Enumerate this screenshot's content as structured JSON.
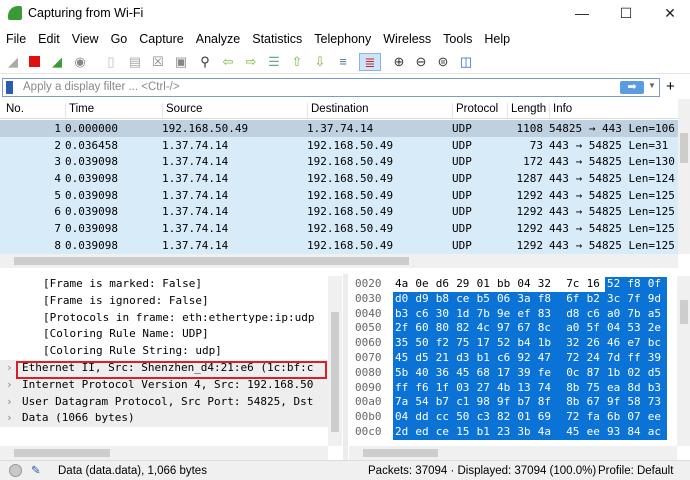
{
  "window": {
    "title": "Capturing from Wi-Fi"
  },
  "menu": [
    "File",
    "Edit",
    "View",
    "Go",
    "Capture",
    "Analyze",
    "Statistics",
    "Telephony",
    "Wireless",
    "Tools",
    "Help"
  ],
  "filter": {
    "placeholder": "Apply a display filter ... <Ctrl-/>"
  },
  "packet_list": {
    "columns": [
      "No.",
      "Time",
      "Source",
      "Destination",
      "Protocol",
      "Length",
      "Info"
    ],
    "rows": [
      [
        "1",
        "0.000000",
        "192.168.50.49",
        "1.37.74.14",
        "UDP",
        "1108",
        "54825 → 443 Len=106"
      ],
      [
        "2",
        "0.036458",
        "1.37.74.14",
        "192.168.50.49",
        "UDP",
        "73",
        "443 → 54825 Len=31"
      ],
      [
        "3",
        "0.039098",
        "1.37.74.14",
        "192.168.50.49",
        "UDP",
        "172",
        "443 → 54825 Len=130"
      ],
      [
        "4",
        "0.039098",
        "1.37.74.14",
        "192.168.50.49",
        "UDP",
        "1287",
        "443 → 54825 Len=124"
      ],
      [
        "5",
        "0.039098",
        "1.37.74.14",
        "192.168.50.49",
        "UDP",
        "1292",
        "443 → 54825 Len=125"
      ],
      [
        "6",
        "0.039098",
        "1.37.74.14",
        "192.168.50.49",
        "UDP",
        "1292",
        "443 → 54825 Len=125"
      ],
      [
        "7",
        "0.039098",
        "1.37.74.14",
        "192.168.50.49",
        "UDP",
        "1292",
        "443 → 54825 Len=125"
      ],
      [
        "8",
        "0.039098",
        "1.37.74.14",
        "192.168.50.49",
        "UDP",
        "1292",
        "443 → 54825 Len=125"
      ]
    ]
  },
  "details": {
    "sub": [
      "[Frame is marked: False]",
      "[Frame is ignored: False]",
      "[Protocols in frame: eth:ethertype:ip:udp",
      "[Coloring Rule Name: UDP]",
      "[Coloring Rule String: udp]"
    ],
    "top": [
      "Ethernet II, Src: Shenzhen_d4:21:e6 (1c:bf:c",
      "Internet Protocol Version 4, Src: 192.168.50",
      "User Datagram Protocol, Src Port: 54825, Dst",
      "Data (1066 bytes)"
    ]
  },
  "hex": [
    [
      "0020",
      "4a 0e d6 29 01 bb 04 32 7c 16 52 f8 0f"
    ],
    [
      "0030",
      "d0 d9 b8 ce b5 06 3a f8 6f b2 3c 7f 9d"
    ],
    [
      "0040",
      "b3 c6 30 1d 7b 9e ef 83 d8 c6 a0 7b a5"
    ],
    [
      "0050",
      "2f 60 80 82 4c 97 67 8c a0 5f 04 53 2e"
    ],
    [
      "0060",
      "35 50 f2 75 17 52 b4 1b 32 26 46 e7 bc"
    ],
    [
      "0070",
      "45 d5 21 d3 b1 c6 92 47 72 24 7d ff 39"
    ],
    [
      "0080",
      "5b 40 36 45 68 17 39 fe 0c 87 1b 02 d5"
    ],
    [
      "0090",
      "ff f6 1f 03 27 4b 13 74 8b 75 ea 8d b3"
    ],
    [
      "00a0",
      "7a 54 b7 c1 98 9f b7 8f 8b 67 9f 58 73"
    ],
    [
      "00b0",
      "04 dd cc 50 c3 82 01 69 72 fa 6b 07 ee"
    ],
    [
      "00c0",
      "2d ed ce 15 b1 23 3b 4a 45 ee 93 84 ac"
    ]
  ],
  "status": {
    "field": "Data (data.data), 1,066 bytes",
    "packets": "Packets: 37094 · Displayed: 37094 (100.0%)",
    "profile": "Profile: Default"
  },
  "colors": {
    "accent": "#0b73d6",
    "row": "#d7ebf9",
    "highlight": "#d9202a"
  }
}
